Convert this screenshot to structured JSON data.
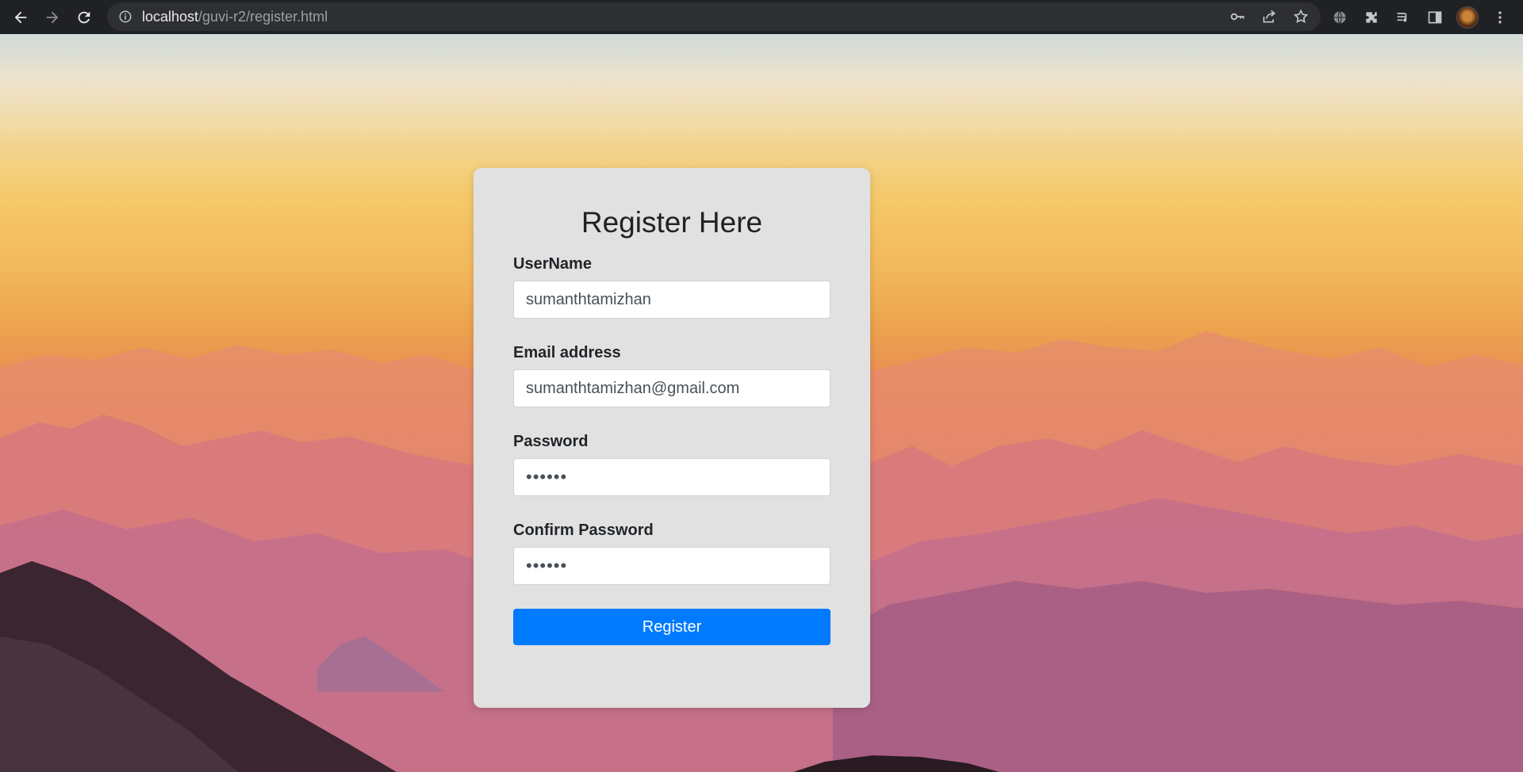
{
  "browser": {
    "url_host": "localhost",
    "url_path": "/guvi-r2/register.html"
  },
  "form": {
    "title": "Register Here",
    "fields": [
      {
        "label": "UserName",
        "value": "sumanthtamizhan",
        "type": "text"
      },
      {
        "label": "Email address",
        "value": "sumanthtamizhan@gmail.com",
        "type": "email"
      },
      {
        "label": "Password",
        "value": "••••••",
        "type": "password"
      },
      {
        "label": "Confirm Password",
        "value": "••••••",
        "type": "password"
      }
    ],
    "submit_label": "Register"
  },
  "colors": {
    "button": "#007bff",
    "card": "#e1e1e1"
  },
  "icons": {
    "omnibox": [
      "key-icon",
      "share-icon",
      "star-icon"
    ],
    "toolbar": [
      "globe-icon",
      "puzzle-icon",
      "media-icon",
      "side-panel-icon",
      "avatar",
      "menu-icon"
    ]
  }
}
